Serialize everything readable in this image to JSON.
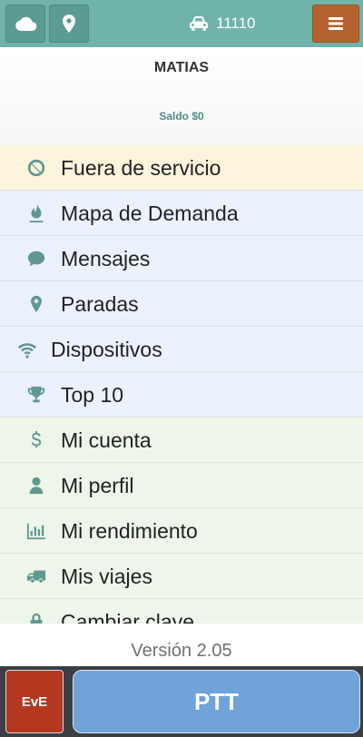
{
  "header": {
    "cloud_icon": "cloud-icon",
    "location_icon": "map-marker-icon",
    "vehicle_icon": "car-icon",
    "vehicle_number": "11110",
    "menu_icon": "hamburger-icon",
    "colors": {
      "bar": "#6fb3aa",
      "menu_button": "#b5622f"
    }
  },
  "profile": {
    "name": "MATIAS",
    "balance": "Saldo $0"
  },
  "menu": {
    "items": [
      {
        "label": "Fuera de servicio",
        "icon": "ban-icon",
        "bg": "#fdf4de"
      },
      {
        "label": "Mapa de Demanda",
        "icon": "fire-icon",
        "bg": "#ebf2fb"
      },
      {
        "label": "Mensajes",
        "icon": "comment-icon",
        "bg": "#ebf2fb"
      },
      {
        "label": "Paradas",
        "icon": "map-marker-icon",
        "bg": "#ebf2fb"
      },
      {
        "label": "Dispositivos",
        "icon": "wifi-icon",
        "bg": "#ebf2fb"
      },
      {
        "label": "Top 10",
        "icon": "trophy-icon",
        "bg": "#ebf2fb"
      },
      {
        "label": "Mi cuenta",
        "icon": "dollar-icon",
        "bg": "#eef6e9"
      },
      {
        "label": "Mi perfil",
        "icon": "user-icon",
        "bg": "#eef6e9"
      },
      {
        "label": "Mi rendimiento",
        "icon": "bar-chart-icon",
        "bg": "#eef6e9"
      },
      {
        "label": "Mis viajes",
        "icon": "truck-icon",
        "bg": "#eef6e9"
      },
      {
        "label": "Cambiar clave",
        "icon": "lock-icon",
        "bg": "#eef6e9"
      }
    ]
  },
  "footer": {
    "version": "Versión 2.05",
    "eve_label": "EvE",
    "ptt_label": "PTT",
    "colors": {
      "eve": "#b5371f",
      "ptt": "#6fa3d9"
    }
  }
}
